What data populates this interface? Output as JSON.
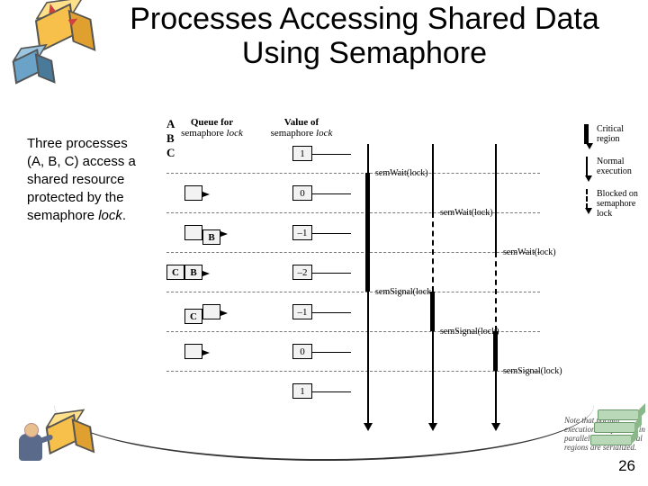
{
  "title": "Processes Accessing Shared Data Using Semaphore",
  "desc_line1": "Three processes",
  "desc_line2": "(A, B, C) access a",
  "desc_line3": "shared resource",
  "desc_line4": "protected by the",
  "desc_line5": "semaphore ",
  "desc_lock": "lock",
  "page": "26",
  "headers": {
    "queue_l1": "Queue for",
    "queue_l2": "semaphore ",
    "queue_lock": "lock",
    "value_l1": "Value of",
    "value_l2": "semaphore ",
    "value_lock": "lock",
    "A": "A",
    "B": "B",
    "C": "C"
  },
  "rows": [
    {
      "queue": [],
      "value": "1"
    },
    {
      "queue": [
        ""
      ],
      "value": "0"
    },
    {
      "queue": [
        "",
        "B"
      ],
      "value": "–1"
    },
    {
      "queue": [
        "C",
        "B"
      ],
      "value": "–2"
    },
    {
      "queue": [
        "C",
        ""
      ],
      "value": "–1"
    },
    {
      "queue": [
        ""
      ],
      "value": "0"
    },
    {
      "queue": [],
      "value": "1"
    }
  ],
  "events": {
    "a_wait": "semWait(lock)",
    "b_wait": "semWait(lock)",
    "c_wait": "semWait(lock)",
    "a_sig": "semSignal(lock)",
    "b_sig": "semSignal(lock)",
    "c_sig": "semSignal(lock)"
  },
  "legend": {
    "crit": "Critical region",
    "normal": "Normal execution",
    "block": "Blocked on semaphore lock"
  },
  "note": "Note that normal execution can proceed in parallel but that critical regions are serialized."
}
